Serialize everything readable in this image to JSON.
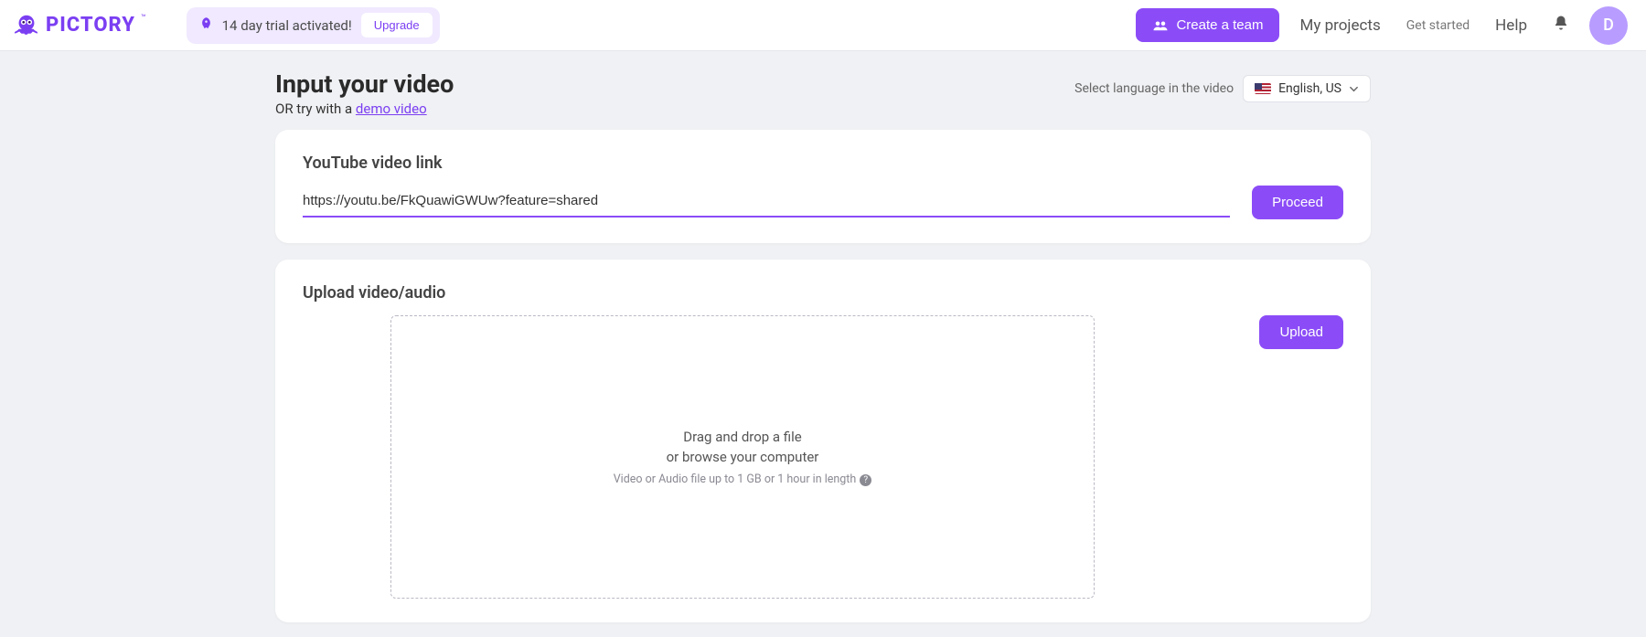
{
  "header": {
    "brand": "PICTORY",
    "trial_text": "14 day trial activated!",
    "upgrade_label": "Upgrade",
    "create_team_label": "Create a team",
    "nav_projects": "My projects",
    "nav_getstarted": "Get started",
    "nav_help": "Help",
    "avatar_initial": "D"
  },
  "page": {
    "title": "Input your video",
    "subtitle_prefix": "OR try with a ",
    "demo_link_label": "demo video",
    "lang_label": "Select language in the video",
    "lang_value": "English, US"
  },
  "youtube": {
    "title": "YouTube video link",
    "value": "https://youtu.be/FkQuawiGWUw?feature=shared",
    "proceed_label": "Proceed"
  },
  "upload": {
    "title": "Upload video/audio",
    "drop_line1": "Drag and drop a file",
    "drop_line2": "or browse your computer",
    "drop_line3": "Video or Audio file up to 1 GB or 1 hour in length",
    "upload_label": "Upload"
  }
}
